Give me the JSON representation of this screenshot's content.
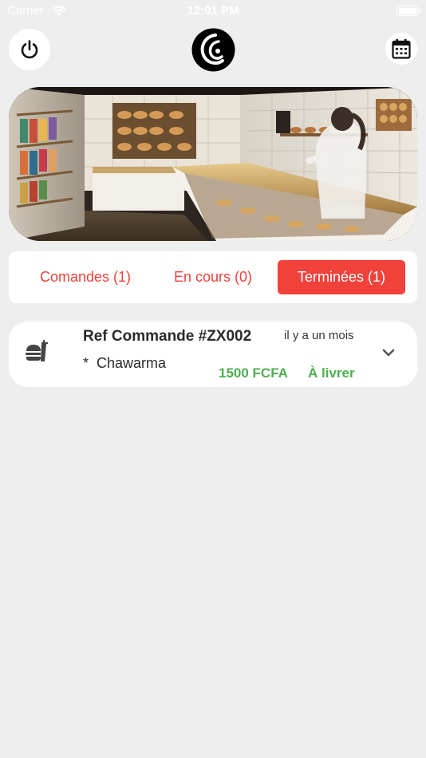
{
  "status_bar": {
    "carrier": "Carrier",
    "time": "12:01 PM"
  },
  "header": {
    "power_icon": "power-icon",
    "calendar_icon": "calendar-icon",
    "logo_icon": "logo-icon"
  },
  "banner": {
    "image": "bakery-shop-photo"
  },
  "tabs": [
    {
      "label": "Comandes (1)",
      "active": false
    },
    {
      "label": "En cours (0)",
      "active": false
    },
    {
      "label": "Terminées (1)",
      "active": true
    }
  ],
  "order": {
    "ref": "Ref Commande #ZX002",
    "time_ago": "il y a un mois",
    "item": "*  Chawarma",
    "price": "1500 FCFA",
    "status": "À livrer",
    "icon": "fastfood-icon"
  },
  "colors": {
    "accent": "#f0413a",
    "success": "#4caf50",
    "background": "#eeeeee"
  }
}
